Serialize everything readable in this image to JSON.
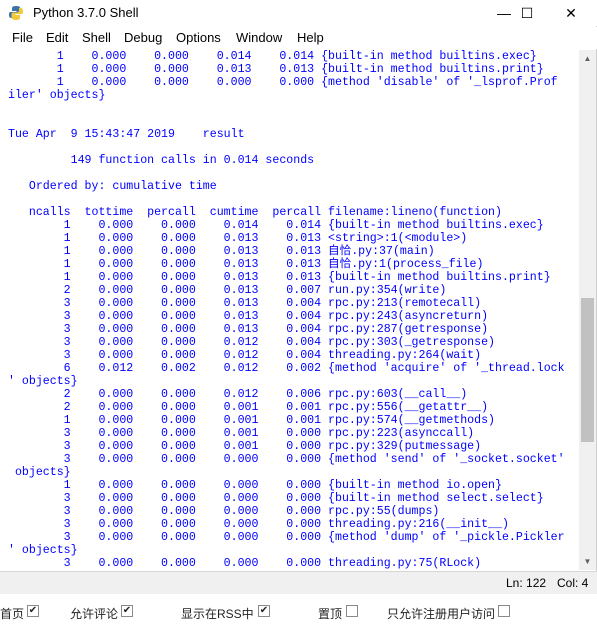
{
  "window": {
    "title": "Python 3.7.0 Shell",
    "minimize": "—",
    "maximize": "☐",
    "close": "✕"
  },
  "menu": [
    "File",
    "Edit",
    "Shell",
    "Debug",
    "Options",
    "Window",
    "Help"
  ],
  "lines": [
    "       1    0.000    0.000    0.014    0.014 {built-in method builtins.exec}",
    "       1    0.000    0.000    0.013    0.013 {built-in method builtins.print}",
    "       1    0.000    0.000    0.000    0.000 {method 'disable' of '_lsprof.Prof",
    "iler' objects}",
    "",
    "",
    "Tue Apr  9 15:43:47 2019    result",
    "",
    "         149 function calls in 0.014 seconds",
    "",
    "   Ordered by: cumulative time",
    "",
    "   ncalls  tottime  percall  cumtime  percall filename:lineno(function)",
    "        1    0.000    0.000    0.014    0.014 {built-in method builtins.exec}",
    "        1    0.000    0.000    0.013    0.013 <string>:1(<module>)",
    "        1    0.000    0.000    0.013    0.013 自恰.py:37(main)",
    "        1    0.000    0.000    0.013    0.013 自恰.py:1(process_file)",
    "        1    0.000    0.000    0.013    0.013 {built-in method builtins.print}",
    "        2    0.000    0.000    0.013    0.007 run.py:354(write)",
    "        3    0.000    0.000    0.013    0.004 rpc.py:213(remotecall)",
    "        3    0.000    0.000    0.013    0.004 rpc.py:243(asyncreturn)",
    "        3    0.000    0.000    0.013    0.004 rpc.py:287(getresponse)",
    "        3    0.000    0.000    0.012    0.004 rpc.py:303(_getresponse)",
    "        3    0.000    0.000    0.012    0.004 threading.py:264(wait)",
    "        6    0.012    0.002    0.012    0.002 {method 'acquire' of '_thread.lock",
    "' objects}",
    "        2    0.000    0.000    0.012    0.006 rpc.py:603(__call__)",
    "        2    0.000    0.000    0.001    0.001 rpc.py:556(__getattr__)",
    "        1    0.000    0.000    0.001    0.001 rpc.py:574(__getmethods)",
    "        3    0.000    0.000    0.001    0.000 rpc.py:223(asynccall)",
    "        3    0.000    0.000    0.001    0.000 rpc.py:329(putmessage)",
    "        3    0.000    0.000    0.000    0.000 {method 'send' of '_socket.socket'",
    " objects}",
    "        1    0.000    0.000    0.000    0.000 {built-in method io.open}",
    "        3    0.000    0.000    0.000    0.000 {built-in method select.select}",
    "        3    0.000    0.000    0.000    0.000 rpc.py:55(dumps)",
    "        3    0.000    0.000    0.000    0.000 threading.py:216(__init__)",
    "        3    0.000    0.000    0.000    0.000 {method 'dump' of '_pickle.Pickler",
    "' objects}",
    "        3    0.000    0.000    0.000    0.000 threading.py:75(RLock)"
  ],
  "status": {
    "line": "Ln: 122",
    "col": "Col: 4"
  },
  "bottom_options": [
    {
      "label": "首页",
      "checked": true
    },
    {
      "label": "允许评论",
      "checked": true
    },
    {
      "label": "显示在RSS中",
      "checked": true
    },
    {
      "label": "置顶",
      "checked": false
    },
    {
      "label": "只允许注册用户访问",
      "checked": false
    }
  ],
  "colors": {
    "code_text": "#0000ff",
    "statusbar_bg": "#f0f0f0"
  }
}
